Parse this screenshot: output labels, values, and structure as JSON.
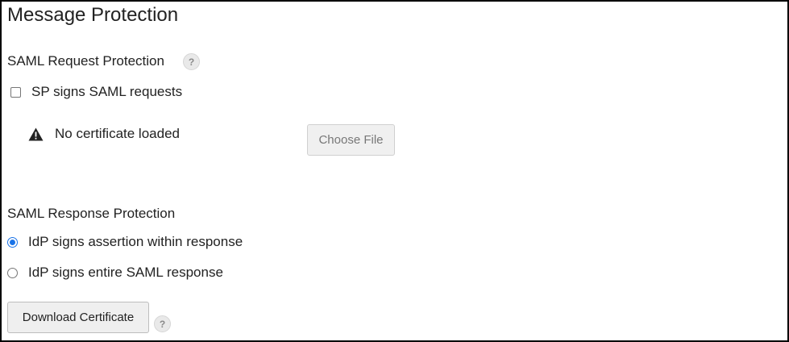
{
  "page": {
    "title": "Message Protection"
  },
  "request_protection": {
    "title": "SAML Request Protection",
    "help_icon": "question-mark-icon",
    "sp_signs_label": "SP signs SAML requests",
    "sp_signs_checked": false,
    "warning_text": "No certificate loaded",
    "warning_icon": "warning-triangle-icon",
    "choose_file_label": "Choose File"
  },
  "response_protection": {
    "title": "SAML Response Protection",
    "options": [
      {
        "label": "IdP signs assertion within response",
        "selected": true
      },
      {
        "label": "IdP signs entire SAML response",
        "selected": false
      }
    ],
    "download_label": "Download Certificate",
    "help_icon": "question-mark-icon"
  },
  "colors": {
    "radio_accent": "#1a73e8",
    "border": "#000000"
  }
}
